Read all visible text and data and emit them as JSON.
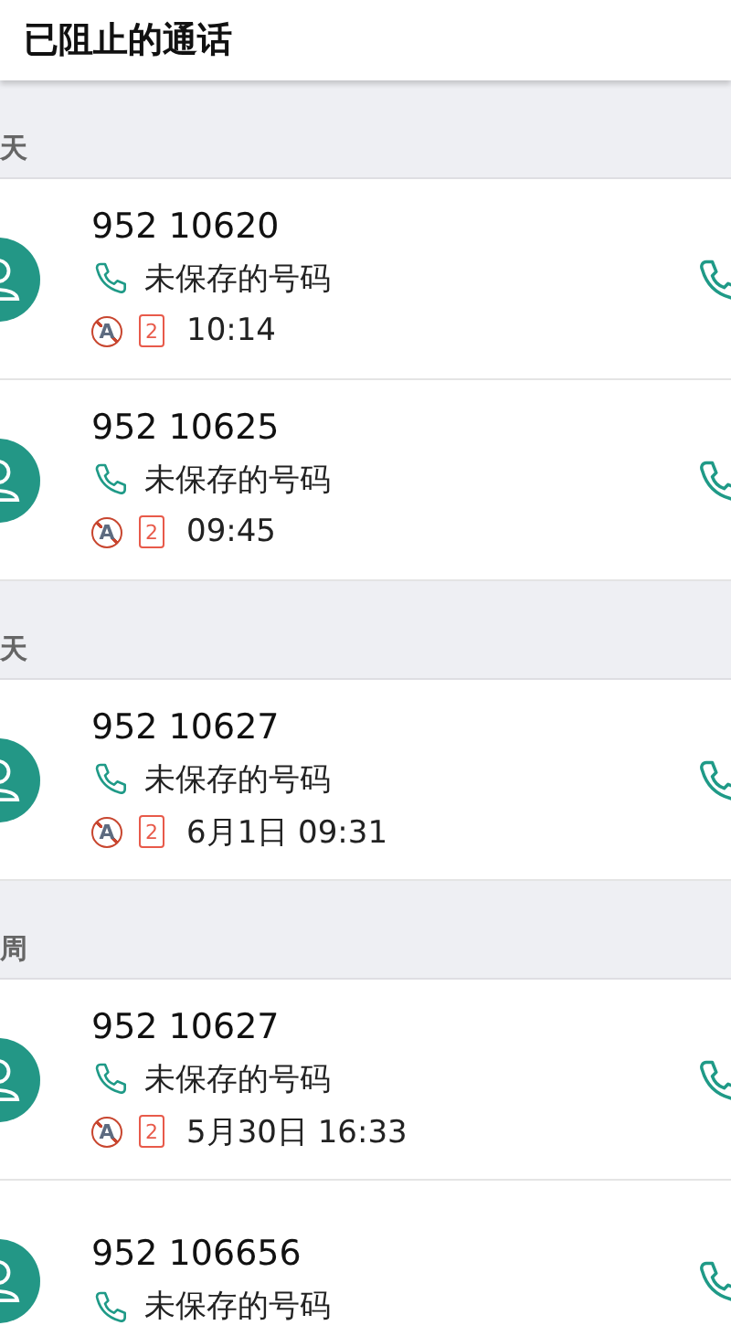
{
  "window": {
    "title": "已阻止的通话"
  },
  "sections": [
    {
      "header": "天",
      "calls": [
        {
          "number": "952 10620",
          "label": "未保存的号码",
          "blocked_mark": "A",
          "sim": "2",
          "time": "10:14"
        },
        {
          "number": "952 10625",
          "label": "未保存的号码",
          "blocked_mark": "A",
          "sim": "2",
          "time": "09:45"
        }
      ]
    },
    {
      "header": "天",
      "calls": [
        {
          "number": "952 10627",
          "label": "未保存的号码",
          "blocked_mark": "A",
          "sim": "2",
          "time": "6月1日 09:31"
        }
      ]
    },
    {
      "header": "周",
      "calls": [
        {
          "number": "952 10627",
          "label": "未保存的号码",
          "blocked_mark": "A",
          "sim": "2",
          "time": "5月30日 16:33"
        },
        {
          "number": "952 106656",
          "label": "未保存的号码"
        }
      ]
    }
  ]
}
